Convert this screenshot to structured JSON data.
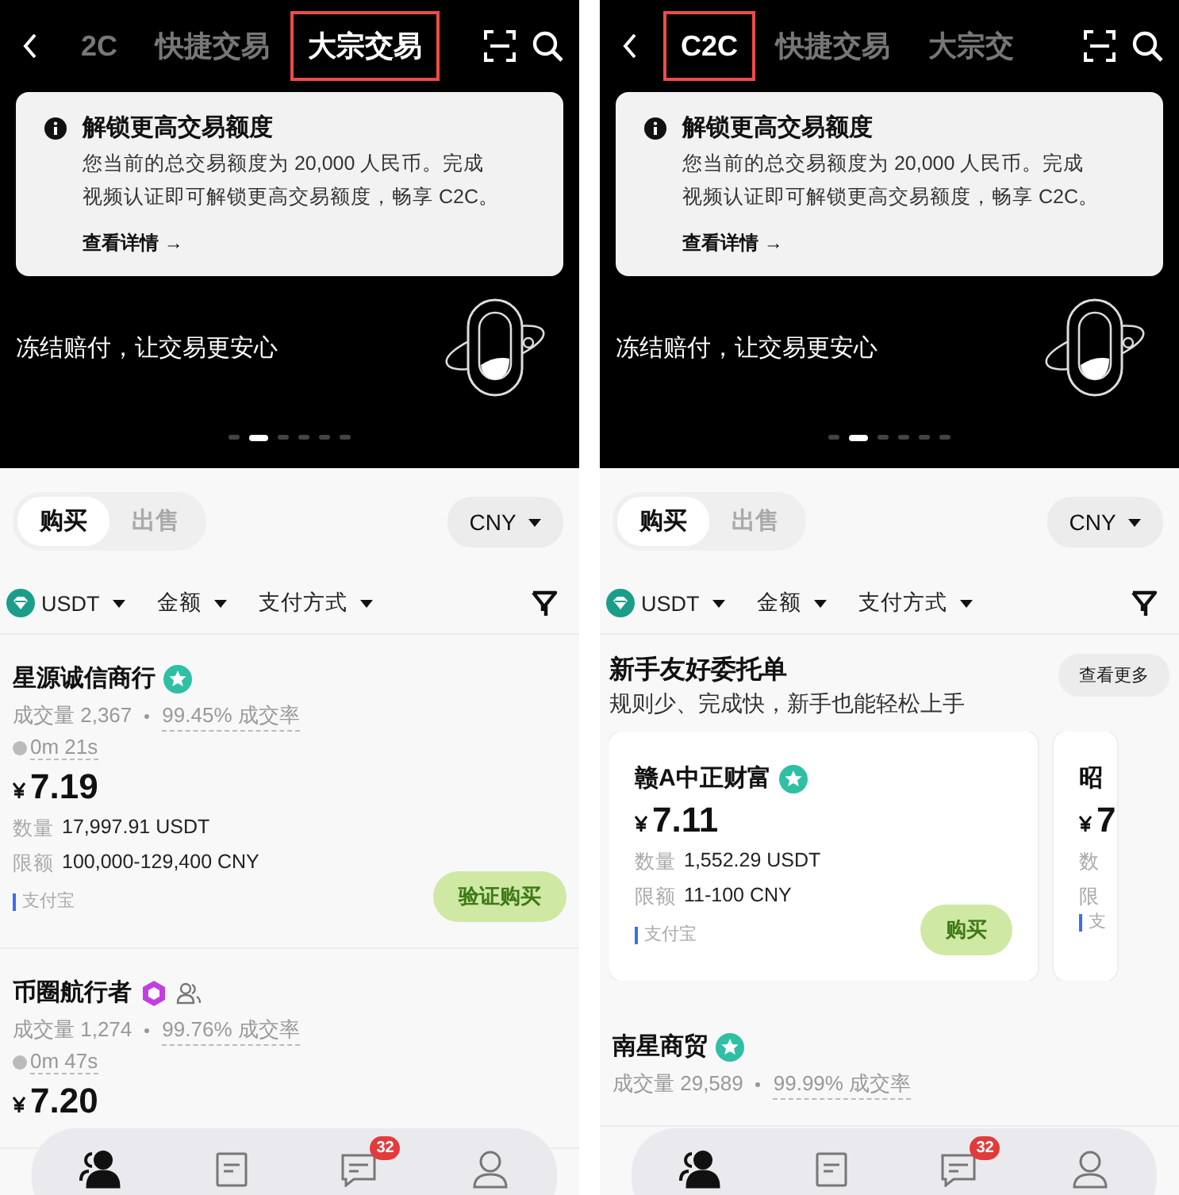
{
  "panels": [
    {
      "tabs": [
        {
          "label": "2C",
          "selected": false
        },
        {
          "label": "快捷交易",
          "selected": false
        },
        {
          "label": "大宗交易",
          "selected": true
        }
      ],
      "notice": {
        "title": "解锁更高交易额度",
        "lines": [
          "您当前的总交易额度为 20,000 人民币。完成",
          "视频认证即可解锁更高交易额度，畅享 C2C。"
        ],
        "link": "查看详情 →"
      },
      "banner": "冻结赔付，让交易更安心",
      "dots": [
        {
          "selected": false
        },
        {
          "selected": true
        },
        {
          "selected": false
        },
        {
          "selected": false
        },
        {
          "selected": false
        },
        {
          "selected": false
        }
      ],
      "sides": [
        {
          "label": "购买",
          "selected": true
        },
        {
          "label": "出售",
          "selected": false
        }
      ],
      "currency": "CNY",
      "filters": [
        {
          "label": "USDT",
          "kind": "token"
        },
        {
          "label": "金额",
          "kind": "plain"
        },
        {
          "label": "支付方式",
          "kind": "plain"
        }
      ],
      "offers": [
        {
          "name": "星源诚信商行",
          "badges": [
            {
              "kind": "verified"
            }
          ],
          "volume": "成交量 2,367",
          "rate": "99.45% 成交率",
          "time": "0m 21s",
          "price": "7.19",
          "details": [
            {
              "label": "数量",
              "value": "17,997.91 USDT"
            },
            {
              "label": "限额",
              "value": "100,000-129,400 CNY"
            }
          ],
          "payment": "支付宝",
          "button": "验证购买"
        },
        {
          "name": "币圈航行者",
          "badges": [
            {
              "kind": "hexagon"
            },
            {
              "kind": "group"
            }
          ],
          "volume": "成交量 1,274",
          "rate": "99.76% 成交率",
          "time": "0m 47s",
          "price": "7.20"
        }
      ],
      "nav": [
        {
          "kind": "people",
          "selected": true
        },
        {
          "kind": "orders",
          "selected": false
        },
        {
          "kind": "chat",
          "selected": false,
          "badge": "32"
        },
        {
          "kind": "profile",
          "selected": false
        }
      ]
    },
    {
      "tabs": [
        {
          "label": "C2C",
          "selected": true
        },
        {
          "label": "快捷交易",
          "selected": false
        },
        {
          "label": "大宗交",
          "selected": false
        }
      ],
      "notice": {
        "title": "解锁更高交易额度",
        "lines": [
          "您当前的总交易额度为 20,000 人民币。完成",
          "视频认证即可解锁更高交易额度，畅享 C2C。"
        ],
        "link": "查看详情 →"
      },
      "banner": "冻结赔付，让交易更安心",
      "dots": [
        {
          "selected": false
        },
        {
          "selected": true
        },
        {
          "selected": false
        },
        {
          "selected": false
        },
        {
          "selected": false
        },
        {
          "selected": false
        }
      ],
      "sides": [
        {
          "label": "购买",
          "selected": true
        },
        {
          "label": "出售",
          "selected": false
        }
      ],
      "currency": "CNY",
      "filters": [
        {
          "label": "USDT",
          "kind": "token"
        },
        {
          "label": "金额",
          "kind": "plain"
        },
        {
          "label": "支付方式",
          "kind": "plain"
        }
      ],
      "section": {
        "title": "新手友好委托单",
        "subtitle": "规则少、完成快，新手也能轻松上手",
        "more": "查看更多",
        "cards": [
          {
            "name": "赣A中正财富",
            "badges": [
              {
                "kind": "verified"
              }
            ],
            "price": "7.11",
            "details": [
              {
                "label": "数量",
                "value": "1,552.29 USDT"
              },
              {
                "label": "限额",
                "value": "11-100 CNY"
              }
            ],
            "payment": "支付宝",
            "button": "购买"
          },
          {
            "name": "昭",
            "price": "7",
            "details": [
              {
                "label": "数"
              },
              {
                "label": "限"
              }
            ],
            "payment": "支"
          }
        ]
      },
      "offers": [
        {
          "name": "南星商贸",
          "badges": [
            {
              "kind": "verified"
            }
          ],
          "volume": "成交量 29,589",
          "rate": "99.99% 成交率"
        }
      ],
      "nav": [
        {
          "kind": "people",
          "selected": true
        },
        {
          "kind": "orders",
          "selected": false
        },
        {
          "kind": "chat",
          "selected": false,
          "badge": "32"
        },
        {
          "kind": "profile",
          "selected": false
        }
      ]
    }
  ]
}
